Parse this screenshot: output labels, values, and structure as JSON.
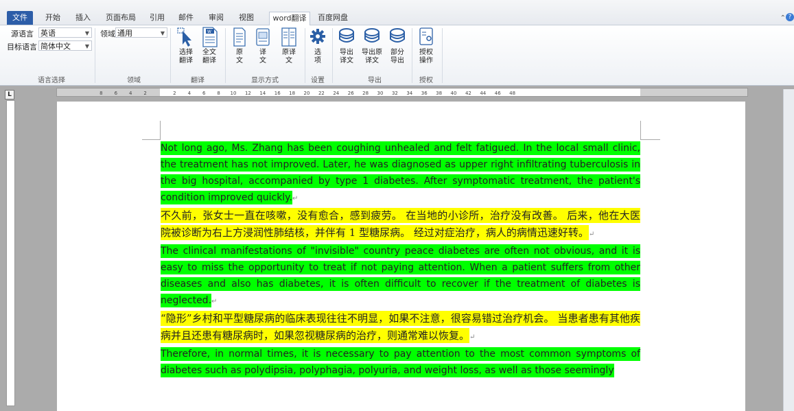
{
  "tabs": [
    "文件",
    "开始",
    "插入",
    "页面布局",
    "引用",
    "邮件",
    "审阅",
    "视图",
    "word翻译",
    "百度网盘"
  ],
  "active_tab": "word翻译",
  "ribbon": {
    "language": {
      "source_label": "源语言",
      "source_value": "英语",
      "target_label": "目标语言",
      "target_value": "简体中文",
      "group": "语言选择"
    },
    "domain": {
      "label": "领域",
      "value": "通用",
      "group": "领域"
    },
    "translate": {
      "select_translate": [
        "选择",
        "翻译"
      ],
      "full_translate": [
        "全文",
        "翻译"
      ],
      "group": "翻译"
    },
    "display": {
      "original": [
        "原",
        "文"
      ],
      "translation": [
        "译",
        "文"
      ],
      "original_translation": [
        "原译",
        "文"
      ],
      "group": "显示方式"
    },
    "settings": {
      "options": [
        "选",
        "项"
      ],
      "group": "设置"
    },
    "export": {
      "export_translation": [
        "导出",
        "译文"
      ],
      "export_original_translation": [
        "导出原",
        "译文"
      ],
      "partial_export": [
        "部分",
        "导出"
      ],
      "group": "导出"
    },
    "authorize": {
      "operation": [
        "授权",
        "操作"
      ],
      "group": "授权"
    }
  },
  "ruler": {
    "corner": "L",
    "left_ticks": [
      "8",
      "6",
      "4",
      "2"
    ],
    "right_ticks": [
      "2",
      "4",
      "6",
      "8",
      "10",
      "12",
      "14",
      "16",
      "18",
      "20",
      "22",
      "24",
      "26",
      "28",
      "30",
      "32",
      "34",
      "36",
      "38",
      "40",
      "42",
      "44",
      "46",
      "48"
    ]
  },
  "document": {
    "paragraphs": [
      {
        "lang": "en",
        "text": "Not long ago, Ms. Zhang has been coughing unhealed and felt fatigued. In the local small clinic, the treatment has not improved. Later, he was diagnosed as upper right infiltrating tuberculosis in the big hospital, accompanied by type 1 diabetes. After symptomatic treatment, the patient's condition improved quickly."
      },
      {
        "lang": "zh",
        "text": "不久前，张女士一直在咳嗽，没有愈合，感到疲劳。 在当地的小诊所，治疗没有改善。 后来，他在大医院被诊断为右上方浸润性肺结核，并伴有 1 型糖尿病。 经过对症治疗，病人的病情迅速好转。"
      },
      {
        "lang": "en",
        "text": "The clinical manifestations of \"invisible\" country peace diabetes are often not obvious, and it is easy to miss the opportunity to treat if not paying attention. When a patient suffers from other diseases and also has diabetes, it is often difficult to recover if the treatment of diabetes is neglected."
      },
      {
        "lang": "zh",
        "text": "“隐形”乡村和平型糖尿病的临床表现往往不明显，如果不注意，很容易错过治疗机会。 当患者患有其他疾病并且还患有糖尿病时，如果忽视糖尿病的治疗，则通常难以恢复。"
      },
      {
        "lang": "en",
        "text": "Therefore, in normal times, it is necessary to pay attention to the most common symptoms of diabetes such as polydipsia, polyphagia, polyuria, and weight loss, as well as those seemingly"
      }
    ]
  },
  "colors": {
    "english_highlight": "#00ff00",
    "chinese_highlight": "#ffff00",
    "file_tab": "#2c5da8"
  }
}
